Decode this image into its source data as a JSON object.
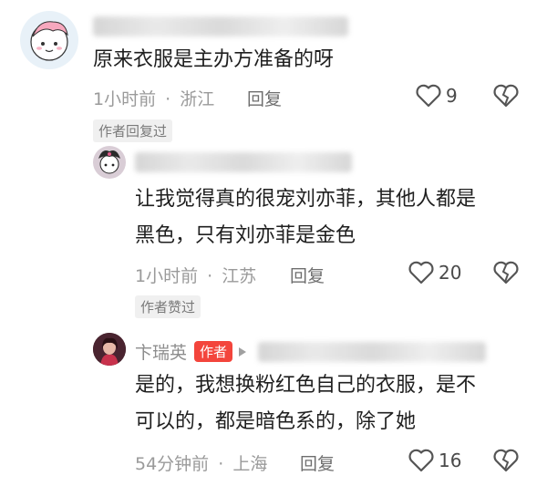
{
  "comments": [
    {
      "text_lines": [
        "原来衣服是主办方准备的呀"
      ],
      "time": "1小时前",
      "location": "浙江",
      "reply_label": "回复",
      "likes": "9",
      "badge": "作者回复过"
    },
    {
      "text_lines": [
        "让我觉得真的很宠刘亦菲，其他人都是",
        "黑色，只有刘亦菲是金色"
      ],
      "time": "1小时前",
      "location": "江苏",
      "reply_label": "回复",
      "likes": "20",
      "badge": "作者赞过"
    },
    {
      "user_name": "卞瑞英",
      "author_tag": "作者",
      "text_lines": [
        "是的，我想换粉红色自己的衣服，是不",
        "可以的，都是暗色系的，除了她"
      ],
      "time": "54分钟前",
      "location": "上海",
      "reply_label": "回复",
      "likes": "16"
    }
  ],
  "separator": "·",
  "icons": {
    "like": "heart-outline-icon",
    "dislike": "broken-heart-icon",
    "reply_arrow": "play-arrow-icon"
  },
  "colors": {
    "author_tag_bg": "#f3453c",
    "meta_text": "#9a9a9a"
  }
}
